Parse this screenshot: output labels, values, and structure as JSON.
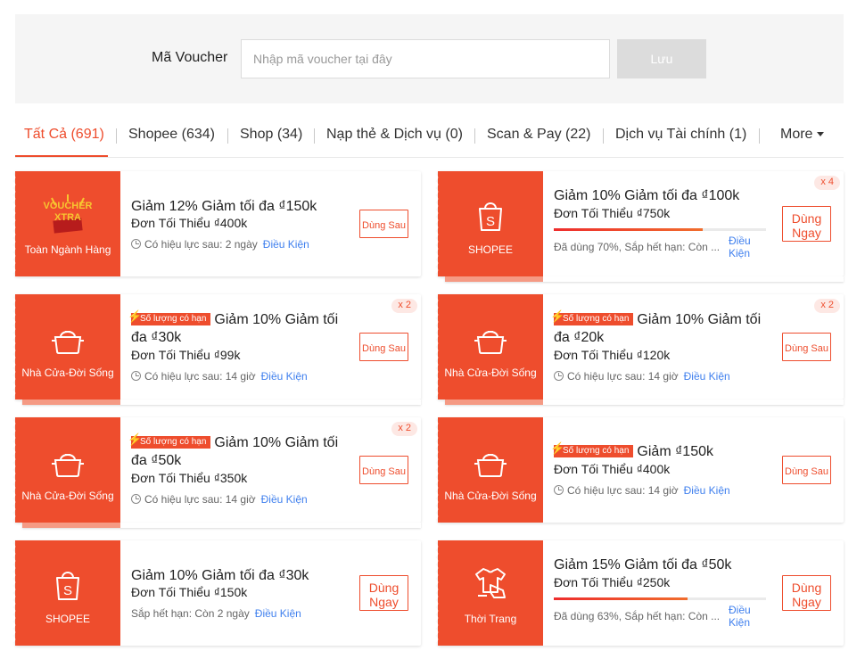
{
  "voucher_bar": {
    "label": "Mã Voucher",
    "placeholder": "Nhập mã voucher tại đây",
    "save_label": "Lưu"
  },
  "tabs": [
    {
      "label": "Tất Cả (691)",
      "active": true
    },
    {
      "label": "Shopee (634)"
    },
    {
      "label": "Shop (34)"
    },
    {
      "label": "Nạp thẻ & Dịch vụ (0)"
    },
    {
      "label": "Scan & Pay (22)"
    },
    {
      "label": "Dịch vụ Tài chính (1)"
    },
    {
      "label": "More"
    }
  ],
  "colors": {
    "accent": "#ee4d2d",
    "link": "#4080ee",
    "tag_bg": "#ee4d2d"
  },
  "vouchers": [
    {
      "category": "Toàn Ngành Hàng",
      "icon": "voucher-xtra-logo",
      "logo_text": "VOUCHER XTRA",
      "title": "Giảm 12% Giảm tối đa ₫150k",
      "min_spend": "Đơn Tối Thiểu ₫400k",
      "validity": "Có hiệu lực sau: 2 ngày",
      "terms": "Điều Kiện",
      "button": "Dùng Sau"
    },
    {
      "category": "SHOPEE",
      "icon": "shopee-bag-icon",
      "title": "Giảm 10% Giảm tối đa ₫100k",
      "min_spend": "Đơn Tối Thiểu ₫750k",
      "progress": 0.7,
      "usage": "Đã dùng 70%, Sắp hết hạn: Còn ...",
      "terms": "Điều Kiện",
      "button": "Dùng Ngay",
      "quantity": "x 4"
    },
    {
      "category": "Nhà Cửa-Đời Sống",
      "icon": "cooking-pot-icon",
      "tag": "Số lượng có hạn",
      "title": "Giảm 10% Giảm tối đa ₫30k",
      "min_spend": "Đơn Tối Thiểu ₫99k",
      "validity": "Có hiệu lực sau: 14 giờ",
      "terms": "Điều Kiện",
      "button": "Dùng Sau",
      "quantity": "x 2"
    },
    {
      "category": "Nhà Cửa-Đời Sống",
      "icon": "cooking-pot-icon",
      "tag": "Số lượng có hạn",
      "title": "Giảm 10% Giảm tối đa ₫20k",
      "min_spend": "Đơn Tối Thiểu ₫120k",
      "validity": "Có hiệu lực sau: 14 giờ",
      "terms": "Điều Kiện",
      "button": "Dùng Sau",
      "quantity": "x 2"
    },
    {
      "category": "Nhà Cửa-Đời Sống",
      "icon": "cooking-pot-icon",
      "tag": "Số lượng có hạn",
      "title": "Giảm 10% Giảm tối đa ₫50k",
      "min_spend": "Đơn Tối Thiểu ₫350k",
      "validity": "Có hiệu lực sau: 14 giờ",
      "terms": "Điều Kiện",
      "button": "Dùng Sau",
      "quantity": "x 2"
    },
    {
      "category": "Nhà Cửa-Đời Sống",
      "icon": "cooking-pot-icon",
      "tag": "Số lượng có hạn",
      "title": "Giảm ₫150k",
      "min_spend": "Đơn Tối Thiểu ₫400k",
      "validity": "Có hiệu lực sau: 14 giờ",
      "terms": "Điều Kiện",
      "button": "Dùng Sau"
    },
    {
      "category": "SHOPEE",
      "icon": "shopee-bag-icon",
      "title": "Giảm 10% Giảm tối đa ₫30k",
      "min_spend": "Đơn Tối Thiểu ₫150k",
      "validity": "Sắp hết hạn: Còn 2 ngày",
      "terms": "Điều Kiện",
      "button": "Dùng Ngay"
    },
    {
      "category": "Thời Trang",
      "icon": "fashion-clothes-icon",
      "title": "Giảm 15% Giảm tối đa ₫50k",
      "min_spend": "Đơn Tối Thiểu ₫250k",
      "progress": 0.63,
      "usage": "Đã dùng 63%, Sắp hết hạn: Còn ...",
      "terms": "Điều Kiện",
      "button": "Dùng Ngay"
    }
  ]
}
